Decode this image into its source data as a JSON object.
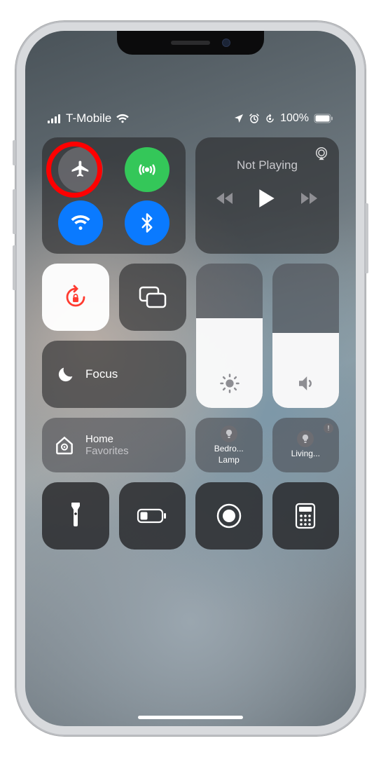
{
  "status": {
    "carrier": "T-Mobile",
    "battery_text": "100%"
  },
  "media": {
    "title": "Not Playing"
  },
  "focus": {
    "label": "Focus"
  },
  "home": {
    "title": "Home",
    "subtitle": "Favorites"
  },
  "accessories": [
    {
      "line1": "Bedro...",
      "line2": "Lamp",
      "warn": false
    },
    {
      "line1": "Living...",
      "line2": "",
      "warn": true
    }
  ],
  "sliders": {
    "brightness_pct": 62,
    "volume_pct": 52
  },
  "highlight": "airplane-mode-button"
}
